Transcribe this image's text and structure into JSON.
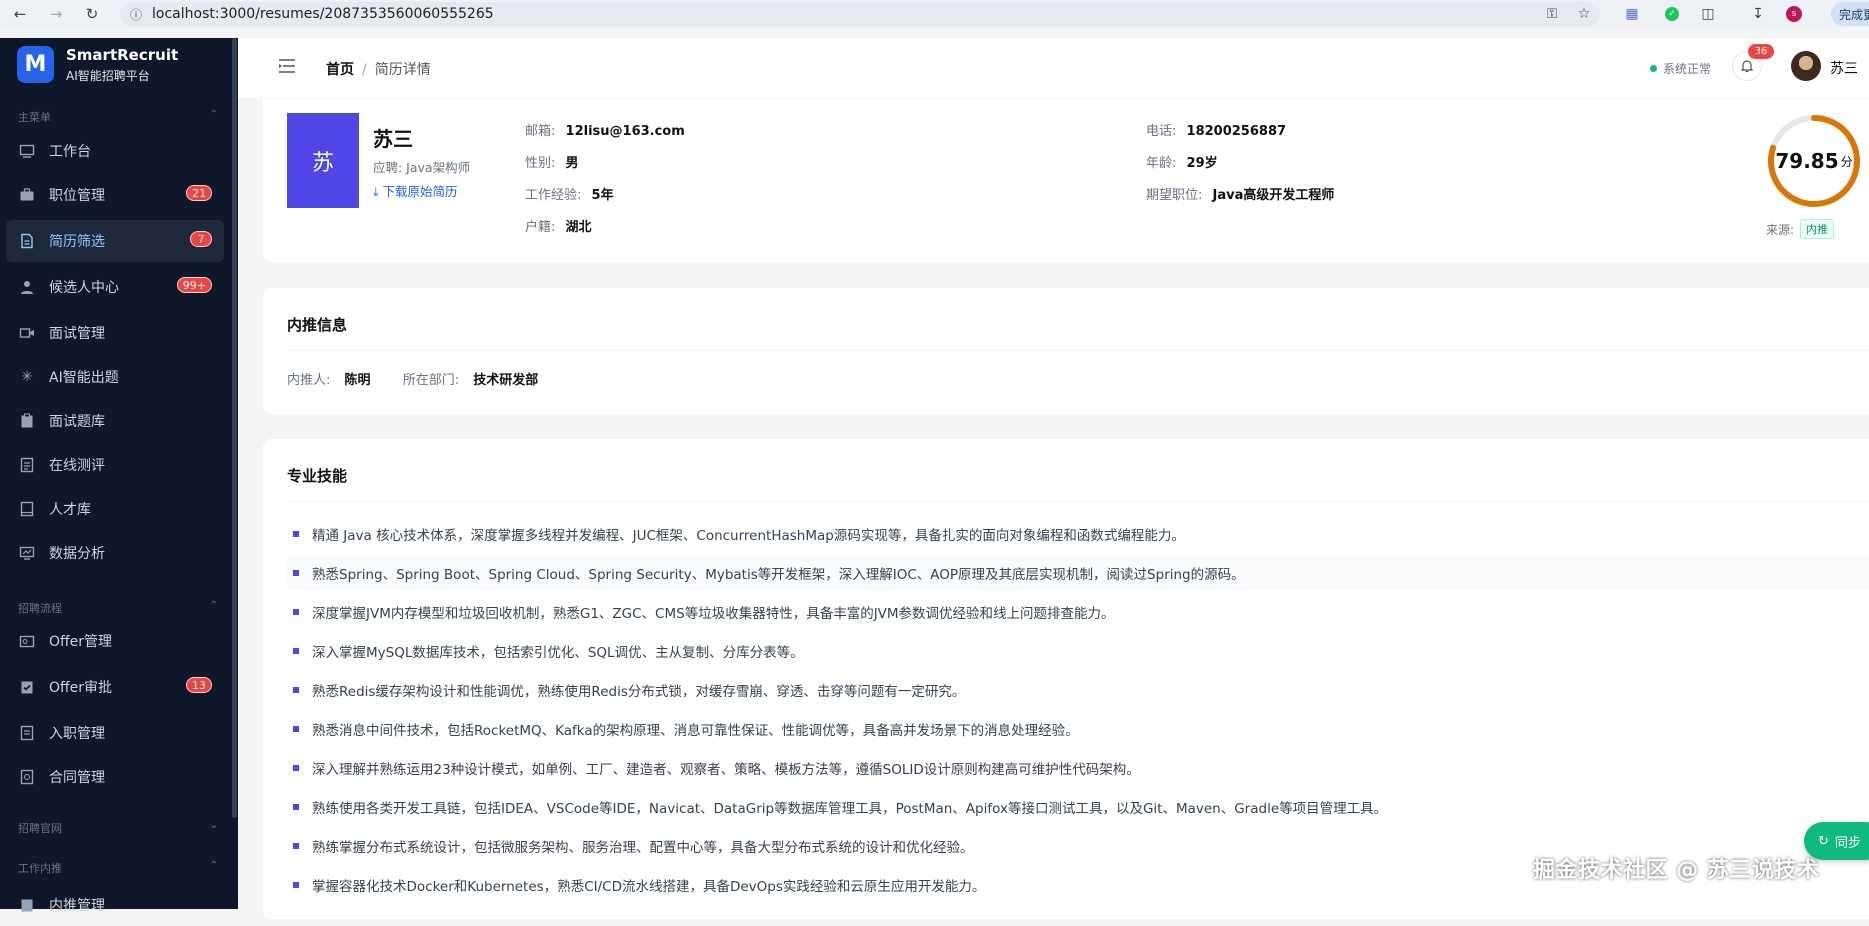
{
  "browser": {
    "url": "localhost:3000/resumes/2087353560060555265",
    "finish_label": "完成更"
  },
  "sidebar": {
    "logo_letter": "M",
    "brand": "SmartRecruit",
    "brand_sub": "AI智能招聘平台",
    "sections": {
      "main": "主菜单",
      "recruit": "招聘流程",
      "site": "招聘官网",
      "internal": "工作内推"
    },
    "items": [
      {
        "label": "工作台",
        "icon": "dashboard-icon"
      },
      {
        "label": "职位管理",
        "icon": "briefcase-icon",
        "badge": "21"
      },
      {
        "label": "简历筛选",
        "icon": "document-icon",
        "badge": "7",
        "active": true
      },
      {
        "label": "候选人中心",
        "icon": "user-icon",
        "badge": "99+"
      },
      {
        "label": "面试管理",
        "icon": "video-icon"
      },
      {
        "label": "AI智能出题",
        "icon": "sparkle-icon"
      },
      {
        "label": "面试题库",
        "icon": "clipboard-icon"
      },
      {
        "label": "在线测评",
        "icon": "test-icon"
      },
      {
        "label": "人才库",
        "icon": "book-icon"
      },
      {
        "label": "数据分析",
        "icon": "chart-icon"
      },
      {
        "label": "Offer管理",
        "icon": "offer-icon"
      },
      {
        "label": "Offer审批",
        "icon": "approve-icon",
        "badge": "13"
      },
      {
        "label": "入职管理",
        "icon": "onboard-icon"
      },
      {
        "label": "合同管理",
        "icon": "contract-icon"
      },
      {
        "label": "内推管理",
        "icon": "referral-icon"
      }
    ]
  },
  "header": {
    "breadcrumb_home": "首页",
    "breadcrumb_current": "简历详情",
    "status": "系统正常",
    "notif_count": "36",
    "user": "苏三"
  },
  "profile": {
    "avatar_char": "苏",
    "name": "苏三",
    "apply": "应聘: Java架构师",
    "download": "下载原始简历",
    "fields": {
      "email_k": "邮箱:",
      "email_v": "12lisu@163.com",
      "gender_k": "性别:",
      "gender_v": "男",
      "exp_k": "工作经验:",
      "exp_v": "5年",
      "origin_k": "户籍:",
      "origin_v": "湖北",
      "phone_k": "电话:",
      "phone_v": "18200256887",
      "age_k": "年龄:",
      "age_v": "29岁",
      "expect_k": "期望职位:",
      "expect_v": "Java高级开发工程师"
    },
    "score": "79.85",
    "score_unit": "分",
    "score_fraction": 0.7985,
    "source_k": "来源:",
    "source_v": "内推"
  },
  "referral": {
    "title": "内推信息",
    "referrer_k": "内推人:",
    "referrer_v": "陈明",
    "dept_k": "所在部门:",
    "dept_v": "技术研发部"
  },
  "skills": {
    "title": "专业技能",
    "items": [
      "精通 Java 核心技术体系，深度掌握多线程并发编程、JUC框架、ConcurrentHashMap源码实现等，具备扎实的面向对象编程和函数式编程能力。",
      "熟悉Spring、Spring Boot、Spring Cloud、Spring Security、Mybatis等开发框架，深入理解IOC、AOP原理及其底层实现机制，阅读过Spring的源码。",
      "深度掌握JVM内存模型和垃圾回收机制，熟悉G1、ZGC、CMS等垃圾收集器特性，具备丰富的JVM参数调优经验和线上问题排查能力。",
      "深入掌握MySQL数据库技术，包括索引优化、SQL调优、主从复制、分库分表等。",
      "熟悉Redis缓存架构设计和性能调优，熟练使用Redis分布式锁，对缓存雪崩、穿透、击穿等问题有一定研究。",
      "熟悉消息中间件技术，包括RocketMQ、Kafka的架构原理、消息可靠性保证、性能调优等，具备高并发场景下的消息处理经验。",
      "深入理解并熟练运用23种设计模式，如单例、工厂、建造者、观察者、策略、模板方法等，遵循SOLID设计原则构建高可维护性代码架构。",
      "熟练使用各类开发工具链，包括IDEA、VSCode等IDE，Navicat、DataGrip等数据库管理工具，PostMan、Apifox等接口测试工具，以及Git、Maven、Gradle等项目管理工具。",
      "熟练掌握分布式系统设计，包括微服务架构、服务治理、配置中心等，具备大型分布式系统的设计和优化经验。",
      "掌握容器化技术Docker和Kubernetes，熟悉CI/CD流水线搭建，具备DevOps实践经验和云原生应用开发能力。"
    ]
  },
  "watermark": "掘金技术社区 @ 苏三说技术",
  "sync_label": "同步",
  "colors": {
    "sidebar_bg": "#0f172a",
    "accent": "#4f46e5",
    "score_ring": "#d97706",
    "badge": "#ef4444",
    "success": "#10b981"
  }
}
